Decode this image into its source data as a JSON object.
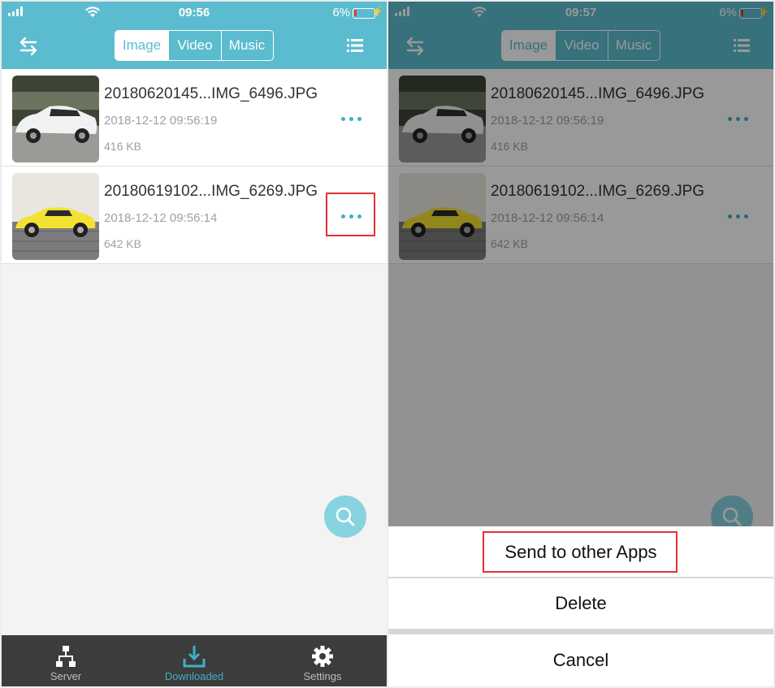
{
  "left": {
    "status": {
      "time": "09:56",
      "battery": "6%"
    },
    "tabs": [
      "Image",
      "Video",
      "Music"
    ],
    "active_tab": "Image",
    "files": [
      {
        "name": "20180620145...IMG_6496.JPG",
        "date": "2018-12-12 09:56:19",
        "size": "416 KB",
        "thumb": "white-car"
      },
      {
        "name": "20180619102...IMG_6269.JPG",
        "date": "2018-12-12 09:56:14",
        "size": "642 KB",
        "thumb": "yellow-car"
      }
    ],
    "bottom_nav": [
      {
        "label": "Server",
        "icon": "network-icon"
      },
      {
        "label": "Downloaded",
        "icon": "download-icon"
      },
      {
        "label": "Settings",
        "icon": "gear-icon"
      }
    ],
    "active_nav": "Downloaded"
  },
  "right": {
    "status": {
      "time": "09:57",
      "battery": "6%"
    },
    "tabs": [
      "Image",
      "Video",
      "Music"
    ],
    "files": [
      {
        "name": "20180620145...IMG_6496.JPG",
        "date": "2018-12-12 09:56:19",
        "size": "416 KB"
      },
      {
        "name": "20180619102...IMG_6269.JPG",
        "date": "2018-12-12 09:56:14",
        "size": "642 KB"
      }
    ],
    "action_sheet": {
      "send": "Send to other Apps",
      "delete": "Delete",
      "cancel": "Cancel"
    }
  },
  "colors": {
    "accent": "#5bbccf",
    "highlight": "#e13333",
    "tabbar": "#3c3c3c"
  }
}
